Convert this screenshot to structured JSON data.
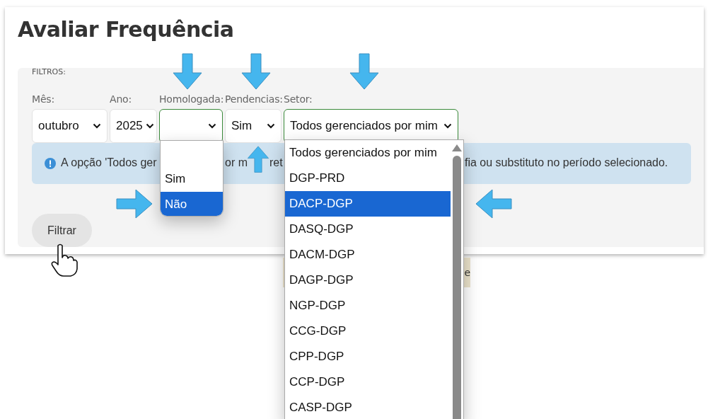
{
  "page": {
    "title": "Avaliar Frequência"
  },
  "filters": {
    "legend": "FILTROS:",
    "fields": [
      {
        "label": "Mês:",
        "value": "outubro",
        "focused": false
      },
      {
        "label": "Ano:",
        "value": "2025",
        "focused": false
      },
      {
        "label": "Homologada:",
        "focused": true
      },
      {
        "label": "Pendencias:",
        "value": "Sim",
        "focused": false
      },
      {
        "label": "Setor:",
        "value": "Todos gerenciados por mim",
        "focused": true
      }
    ]
  },
  "alert": {
    "fragments": [
      "A opção 'Todos ger",
      "or m",
      "ret",
      "fia ou substituto no período selecionado."
    ]
  },
  "filter_button": {
    "label": "Filtrar"
  },
  "behind_text": "e",
  "homologada_list": {
    "options": [
      {
        "kind": "blank",
        "selected": false
      },
      {
        "kind": "text",
        "label": "Sim",
        "selected": false
      },
      {
        "kind": "text",
        "label": "Não",
        "selected": true
      }
    ]
  },
  "setor_list": {
    "options": [
      {
        "label": "Todos gerenciados por mim",
        "selected": false
      },
      {
        "label": "DGP-PRD",
        "selected": false
      },
      {
        "label": "DACP-DGP",
        "selected": true
      },
      {
        "label": "DASQ-DGP",
        "selected": false
      },
      {
        "label": "DACM-DGP",
        "selected": false
      },
      {
        "label": "DAGP-DGP",
        "selected": false
      },
      {
        "label": "NGP-DGP",
        "selected": false
      },
      {
        "label": "CCG-DGP",
        "selected": false
      },
      {
        "label": "CPP-DGP",
        "selected": false
      },
      {
        "label": "CCP-DGP",
        "selected": false
      },
      {
        "label": "CASP-DGP",
        "selected": false
      }
    ]
  }
}
